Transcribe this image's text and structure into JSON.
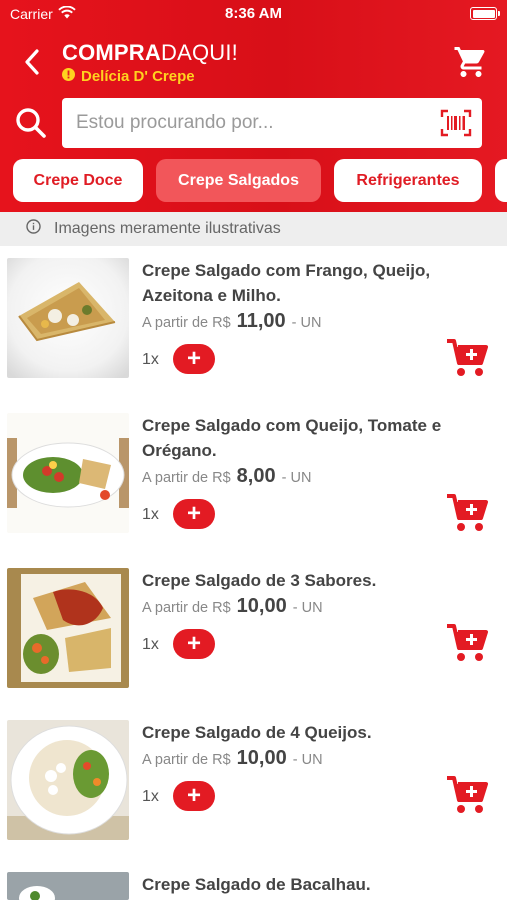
{
  "status_bar": {
    "carrier": "Carrier",
    "time": "8:36 AM"
  },
  "header": {
    "logo_bold": "COMPRA",
    "logo_light": "DAQUI!",
    "store_name": "Delícia D' Crepe",
    "icons": {
      "back": "chevron-left-icon",
      "cart": "shopping-cart-icon",
      "info": "info-icon"
    }
  },
  "search": {
    "placeholder": "Estou procurando por...",
    "value": "",
    "icons": {
      "search": "search-icon",
      "scan": "barcode-scan-icon"
    }
  },
  "categories": [
    {
      "label": "Crepe Doce",
      "active": false
    },
    {
      "label": "Crepe Salgados",
      "active": true
    },
    {
      "label": "Refrigerantes",
      "active": false
    },
    {
      "label": "",
      "active": false
    }
  ],
  "notice": {
    "text": "Imagens meramente ilustrativas",
    "icon": "info-circle-icon"
  },
  "products": [
    {
      "name": "Crepe Salgado com Frango, Queijo, Azeitona e Milho.",
      "price_prefix": "A partir de R$",
      "price": "11,00",
      "unit": "- UN",
      "qty": "1x"
    },
    {
      "name": "Crepe Salgado com Queijo, Tomate e Orégano.",
      "price_prefix": "A partir de R$",
      "price": "8,00",
      "unit": "- UN",
      "qty": "1x"
    },
    {
      "name": "Crepe Salgado de 3 Sabores.",
      "price_prefix": "A partir de R$",
      "price": "10,00",
      "unit": "- UN",
      "qty": "1x"
    },
    {
      "name": "Crepe Salgado de 4 Queijos.",
      "price_prefix": "A partir de R$",
      "price": "10,00",
      "unit": "- UN",
      "qty": "1x"
    },
    {
      "name": "Crepe Salgado de Bacalhau.",
      "price_prefix": "",
      "price": "",
      "unit": "",
      "qty": ""
    }
  ],
  "colors": {
    "brand_red": "#e31b23",
    "active_chip": "#f2565a",
    "store_yellow": "#ffd21f"
  }
}
